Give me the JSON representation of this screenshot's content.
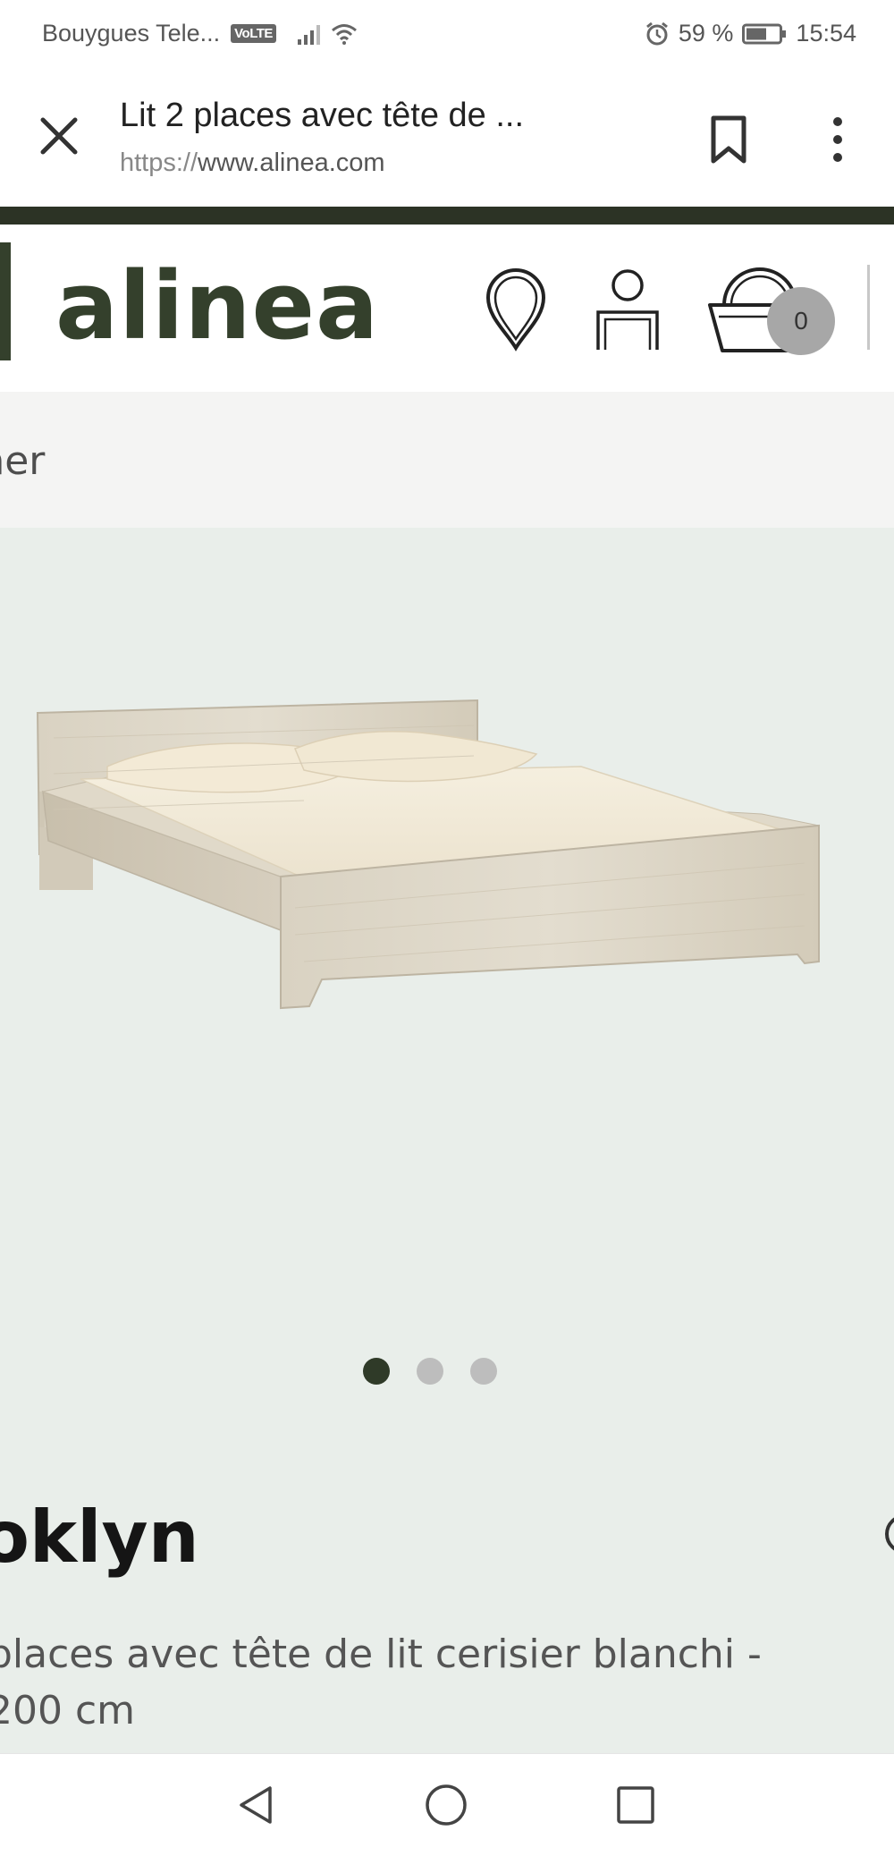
{
  "status_bar": {
    "carrier": "Bouygues Tele...",
    "volte": "VoLTE",
    "battery": "59 %",
    "time": "15:54"
  },
  "browser": {
    "title": "Lit 2 places avec tête de ...",
    "url_scheme": "https://",
    "url_host": "www.alinea.com"
  },
  "site": {
    "logo": "alinea",
    "cart_count": "0",
    "search_placeholder": "rcher"
  },
  "gallery": {
    "image_count": 3,
    "active_index": 0
  },
  "product": {
    "name": "ooklyn",
    "description": "places avec tête de lit cerisier blanchi -\n200 cm"
  },
  "colors": {
    "brand": "#34402c",
    "background": "#e9eeea",
    "dot_active": "#2f3a28",
    "dot_inactive": "#bdbdbd"
  }
}
